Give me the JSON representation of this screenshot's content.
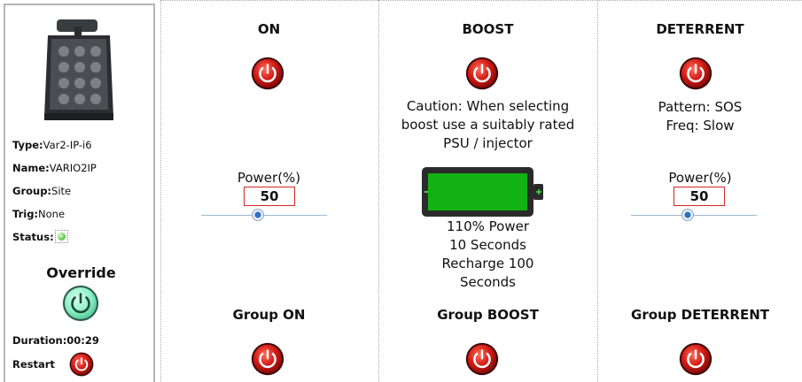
{
  "device": {
    "type_label": "Type:",
    "type_value": "Var2-IP-i6",
    "name_label": "Name:",
    "name_value": "VARIO2IP",
    "group_label": "Group:",
    "group_value": "Site",
    "trig_label": "Trig:",
    "trig_value": "None",
    "status_label": "Status:",
    "status_color": "#6fd15a"
  },
  "override": {
    "title": "Override",
    "button_color": "#8ff0c8",
    "duration_label": "Duration:",
    "duration_value": "00:29",
    "restart_label": "Restart"
  },
  "on": {
    "title": "ON",
    "power_label": "Power(%)",
    "power_value": "50",
    "slider_percent": 50,
    "group_title": "Group ON"
  },
  "boost": {
    "title": "BOOST",
    "caution_line1": "Caution: When selecting",
    "caution_line2": "boost use a suitably rated",
    "caution_line3": "PSU / injector",
    "battery_color": "#12b212",
    "info_line1": "110% Power",
    "info_line2": "10 Seconds",
    "info_line3": "Recharge 100",
    "info_line4": "Seconds",
    "group_title": "Group BOOST"
  },
  "deterrent": {
    "title": "DETERRENT",
    "pattern": "Pattern: SOS",
    "freq": "Freq: Slow",
    "power_label": "Power(%)",
    "power_value": "50",
    "slider_percent": 50,
    "group_title": "Group DETERRENT"
  },
  "colors": {
    "power_button_red": "#c81818",
    "accent_blue": "#2c6fc3"
  }
}
